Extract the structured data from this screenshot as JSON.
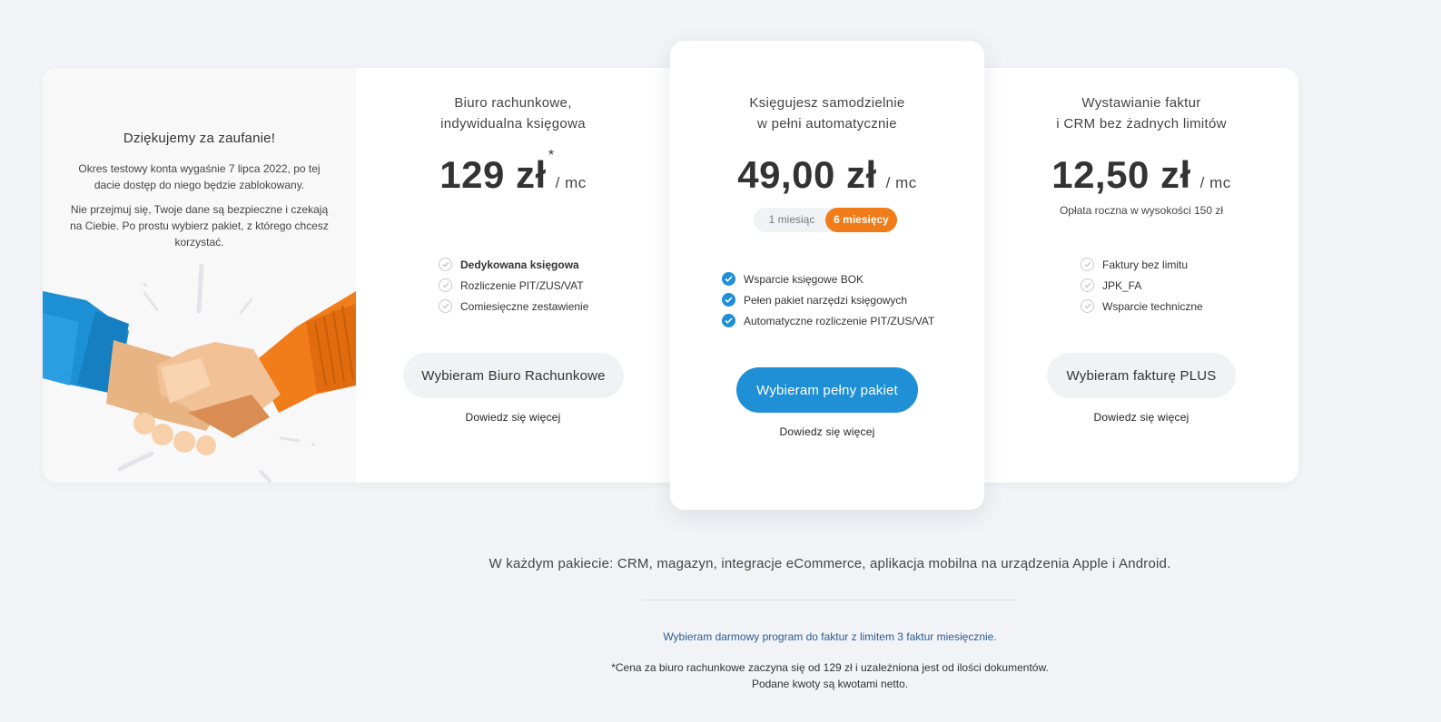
{
  "intro": {
    "title": "Dziękujemy za zaufanie!",
    "paragraph1": "Okres testowy konta wygaśnie 7 lipca 2022, po tej dacie dostęp do niego będzie zablokowany.",
    "paragraph2": "Nie przejmuj się, Twoje dane są bezpieczne i czekają na Ciebie. Po prostu wybierz pakiet, z którego chcesz korzystać."
  },
  "plans": {
    "biuro": {
      "title_line1": "Biuro rachunkowe,",
      "title_line2": "indywidualna księgowa",
      "price": "129 zł",
      "asterisk": "*",
      "unit": "/ mc",
      "features": [
        "Dedykowana księgowa",
        "Rozliczenie PIT/ZUS/VAT",
        "Comiesięczne zestawienie"
      ],
      "button": "Wybieram Biuro Rachunkowe",
      "more": "Dowiedz się więcej"
    },
    "auto": {
      "title_line1": "Księgujesz samodzielnie",
      "title_line2": "w pełni automatycznie",
      "price": "49,00 zł",
      "unit": "/ mc",
      "toggle": {
        "option1": "1 miesiąc",
        "option2": "6 miesięcy",
        "selected": "6 miesięcy"
      },
      "features": [
        "Wsparcie księgowe BOK",
        "Pełen pakiet narzędzi księgowych",
        "Automatyczne rozliczenie PIT/ZUS/VAT"
      ],
      "button": "Wybieram pełny pakiet",
      "more": "Dowiedz się więcej"
    },
    "faktury": {
      "title_line1": "Wystawianie faktur",
      "title_line2": "i CRM bez żadnych limitów",
      "price": "12,50 zł",
      "unit": "/ mc",
      "annual_note": "Opłata roczna w wysokości 150 zł",
      "features": [
        "Faktury bez limitu",
        "JPK_FA",
        "Wsparcie techniczne"
      ],
      "button": "Wybieram fakturę PLUS",
      "more": "Dowiedz się więcej"
    }
  },
  "footer": {
    "every_package": "W każdym pakiecie: CRM, magazyn, integracje eCommerce, aplikacja mobilna na urządzenia Apple i Android.",
    "free_link": "Wybieram darmowy program do faktur z limitem 3 faktur miesięcznie.",
    "footnote_line1": "*Cena za biuro rachunkowe zaczyna się od 129 zł i uzależniona jest od ilości dokumentów.",
    "footnote_line2": "Podane kwoty są kwotami netto."
  },
  "colors": {
    "accent_blue": "#1f8fd6",
    "accent_orange": "#f07c1a",
    "background": "#f2f3f6"
  },
  "icons": [
    "check-circle-icon",
    "handshake-illustration"
  ]
}
